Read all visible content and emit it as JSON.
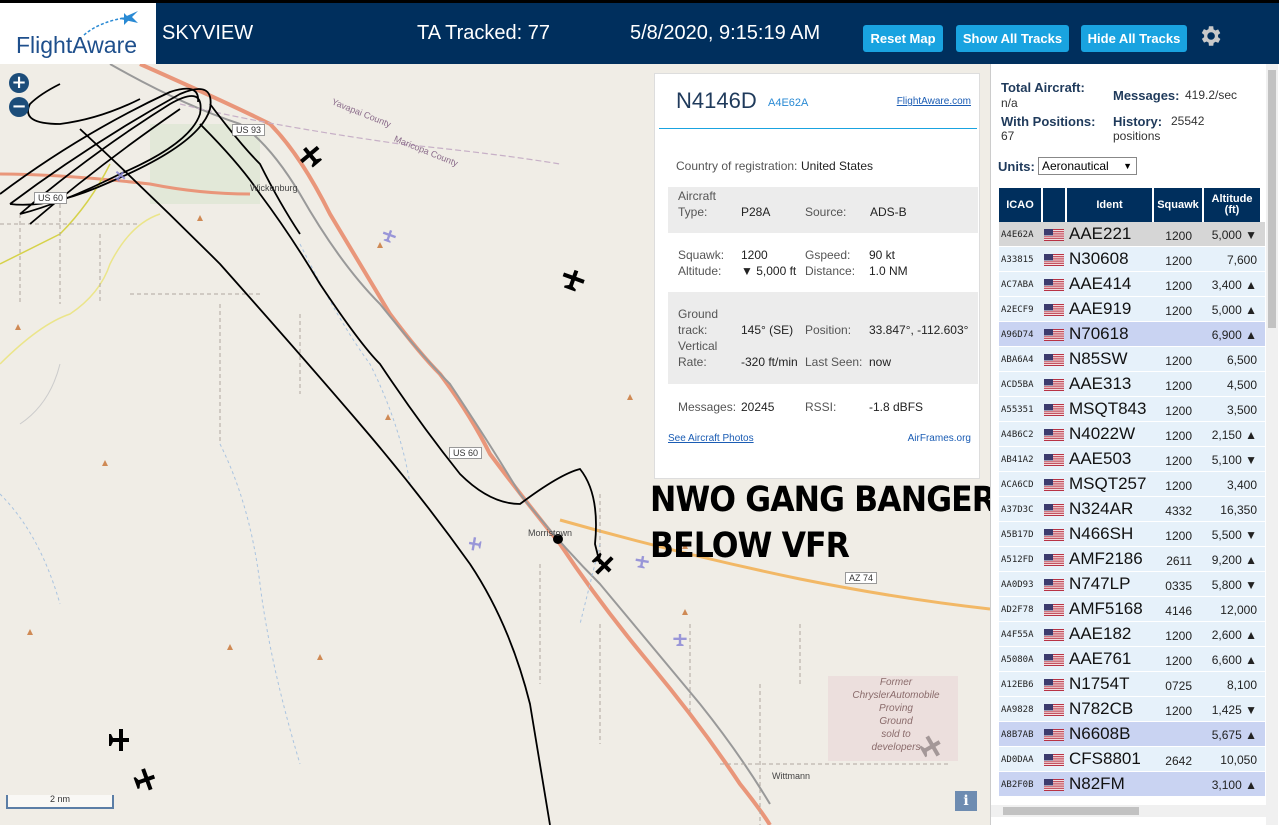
{
  "header": {
    "logo_text": "FlightAware",
    "title": "SKYVIEW",
    "tracked": "TA Tracked: 77",
    "datetime": "5/8/2020, 9:15:19 AM",
    "buttons": {
      "reset": "Reset Map",
      "show_all": "Show All Tracks",
      "hide_all": "Hide All Tracks"
    },
    "colors": {
      "bar": "#002f5d",
      "button": "#19a3e0"
    }
  },
  "map": {
    "zoom_in": "+",
    "zoom_out": "−",
    "scale": "2 nm",
    "info": "i",
    "roads": {
      "us93": "US 93",
      "us60_a": "US 60",
      "us60_b": "US 60",
      "az74": "AZ 74"
    },
    "places": {
      "wickenburg": "Wickenburg",
      "morristown": "Morristown",
      "wittmann": "Wittmann"
    },
    "counties": {
      "yavapai": "Yavapai County",
      "maricopa": "Maricopa County"
    },
    "former_site": [
      "Former",
      "ChryslerAutomobile",
      "Proving",
      "Ground",
      "sold to",
      "developers"
    ],
    "overlay_text": [
      "NWO GANG BANGER",
      "BELOW VFR"
    ]
  },
  "popup": {
    "ident": "N4146D",
    "hex": "A4E62A",
    "fa_link": "FlightAware.com",
    "country_label": "Country of registration:",
    "country": "United States",
    "aircraft_label_1": "Aircraft",
    "aircraft_label_2": "Type:",
    "aircraft_type": "P28A",
    "source_label": "Source:",
    "source": "ADS-B",
    "squawk_label": "Squawk:",
    "squawk": "1200",
    "gspeed_label": "Gspeed:",
    "gspeed": "90 kt",
    "altitude_label": "Altitude:",
    "altitude": "▼ 5,000 ft",
    "distance_label": "Distance:",
    "distance": "1.0 NM",
    "ground_label_1": "Ground",
    "ground_label_2": "track:",
    "ground_track": "145° (SE)",
    "position_label": "Position:",
    "position": "33.847°, -112.603°",
    "vrate_label_1": "Vertical",
    "vrate_label_2": "Rate:",
    "vertical_rate": "-320 ft/min",
    "lastseen_label": "Last Seen:",
    "last_seen": "now",
    "messages_label": "Messages:",
    "messages": "20245",
    "rssi_label": "RSSI:",
    "rssi": "-1.8 dBFS",
    "photos_link": "See Aircraft Photos",
    "airframes_link": "AirFrames.org"
  },
  "side": {
    "total_label": "Total Aircraft:",
    "total": "n/a",
    "messages_label": "Messages:",
    "messages": "419.2/sec",
    "withpos_label": "With Positions:",
    "withpos": "67",
    "history_label": "History:",
    "history_1": "25542",
    "history_2": "positions",
    "units_label": "Units:",
    "units": "Aeronautical",
    "columns": {
      "icao": "ICAO",
      "ident": "Ident",
      "squawk": "Squawk",
      "alt_1": "Altitude",
      "alt_2": "(ft)"
    },
    "rows": [
      {
        "icao": "A4E62A",
        "ident": "AAE221",
        "squawk": "1200",
        "alt": "5,000 ▼",
        "style": "sel"
      },
      {
        "icao": "A33815",
        "ident": "N30608",
        "squawk": "1200",
        "alt": "7,600",
        "style": ""
      },
      {
        "icao": "AC7ABA",
        "ident": "AAE414",
        "squawk": "1200",
        "alt": "3,400 ▲",
        "style": ""
      },
      {
        "icao": "A2ECF9",
        "ident": "AAE919",
        "squawk": "1200",
        "alt": "5,000 ▲",
        "style": ""
      },
      {
        "icao": "A96D74",
        "ident": "N70618",
        "squawk": "",
        "alt": "6,900 ▲",
        "style": "no-sq"
      },
      {
        "icao": "ABA6A4",
        "ident": "N85SW",
        "squawk": "1200",
        "alt": "6,500",
        "style": ""
      },
      {
        "icao": "ACD5BA",
        "ident": "AAE313",
        "squawk": "1200",
        "alt": "4,500",
        "style": ""
      },
      {
        "icao": "A55351",
        "ident": "MSQT843",
        "squawk": "1200",
        "alt": "3,500",
        "style": ""
      },
      {
        "icao": "A4B6C2",
        "ident": "N4022W",
        "squawk": "1200",
        "alt": "2,150 ▲",
        "style": ""
      },
      {
        "icao": "AB41A2",
        "ident": "AAE503",
        "squawk": "1200",
        "alt": "5,100 ▼",
        "style": ""
      },
      {
        "icao": "ACA6CD",
        "ident": "MSQT257",
        "squawk": "1200",
        "alt": "3,400",
        "style": ""
      },
      {
        "icao": "A37D3C",
        "ident": "N324AR",
        "squawk": "4332",
        "alt": "16,350",
        "style": ""
      },
      {
        "icao": "A5B17D",
        "ident": "N466SH",
        "squawk": "1200",
        "alt": "5,500 ▼",
        "style": ""
      },
      {
        "icao": "A512FD",
        "ident": "AMF2186",
        "squawk": "2611",
        "alt": "9,200 ▲",
        "style": ""
      },
      {
        "icao": "AA0D93",
        "ident": "N747LP",
        "squawk": "0335",
        "alt": "5,800 ▼",
        "style": ""
      },
      {
        "icao": "AD2F78",
        "ident": "AMF5168",
        "squawk": "4146",
        "alt": "12,000",
        "style": ""
      },
      {
        "icao": "A4F55A",
        "ident": "AAE182",
        "squawk": "1200",
        "alt": "2,600 ▲",
        "style": ""
      },
      {
        "icao": "A5080A",
        "ident": "AAE761",
        "squawk": "1200",
        "alt": "6,600 ▲",
        "style": ""
      },
      {
        "icao": "A12EB6",
        "ident": "N1754T",
        "squawk": "0725",
        "alt": "8,100",
        "style": ""
      },
      {
        "icao": "AA9828",
        "ident": "N782CB",
        "squawk": "1200",
        "alt": "1,425 ▼",
        "style": ""
      },
      {
        "icao": "A8B7AB",
        "ident": "N6608B",
        "squawk": "",
        "alt": "5,675 ▲",
        "style": "no-sq"
      },
      {
        "icao": "AD0DAA",
        "ident": "CFS8801",
        "squawk": "2642",
        "alt": "10,050",
        "style": ""
      },
      {
        "icao": "AB2F0B",
        "ident": "N82FM",
        "squawk": "",
        "alt": "3,100 ▲",
        "style": "no-sq"
      }
    ]
  }
}
